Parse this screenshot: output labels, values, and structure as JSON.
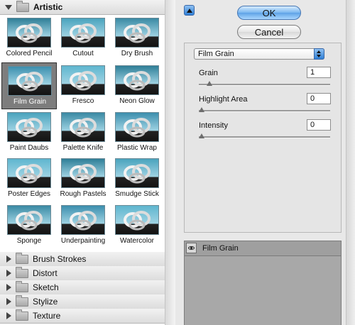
{
  "categories": {
    "expanded": {
      "label": "Artistic",
      "icon": "folder-icon"
    },
    "collapsed": [
      {
        "label": "Brush Strokes"
      },
      {
        "label": "Distort"
      },
      {
        "label": "Sketch"
      },
      {
        "label": "Stylize"
      },
      {
        "label": "Texture"
      }
    ]
  },
  "thumbnails": [
    {
      "label": "Colored Pencil"
    },
    {
      "label": "Cutout"
    },
    {
      "label": "Dry Brush"
    },
    {
      "label": "Film Grain",
      "selected": true
    },
    {
      "label": "Fresco"
    },
    {
      "label": "Neon Glow"
    },
    {
      "label": "Paint Daubs"
    },
    {
      "label": "Palette Knife"
    },
    {
      "label": "Plastic Wrap"
    },
    {
      "label": "Poster Edges"
    },
    {
      "label": "Rough Pastels"
    },
    {
      "label": "Smudge Stick"
    },
    {
      "label": "Sponge"
    },
    {
      "label": "Underpainting"
    },
    {
      "label": "Watercolor"
    }
  ],
  "buttons": {
    "ok": "OK",
    "cancel": "Cancel"
  },
  "filter_select": {
    "value": "Film Grain"
  },
  "params": [
    {
      "label": "Grain",
      "value": "1",
      "slider_fraction": 0.06
    },
    {
      "label": "Highlight Area",
      "value": "0",
      "slider_fraction": 0.0
    },
    {
      "label": "Intensity",
      "value": "0",
      "slider_fraction": 0.0
    }
  ],
  "effect_layer": {
    "name": "Film Grain",
    "visible_icon": "eye-icon"
  },
  "colors": {
    "sky_teal": "#4aa3bd",
    "selected_bg": "#7d7d7d",
    "accent_blue": "#3a83d8"
  }
}
